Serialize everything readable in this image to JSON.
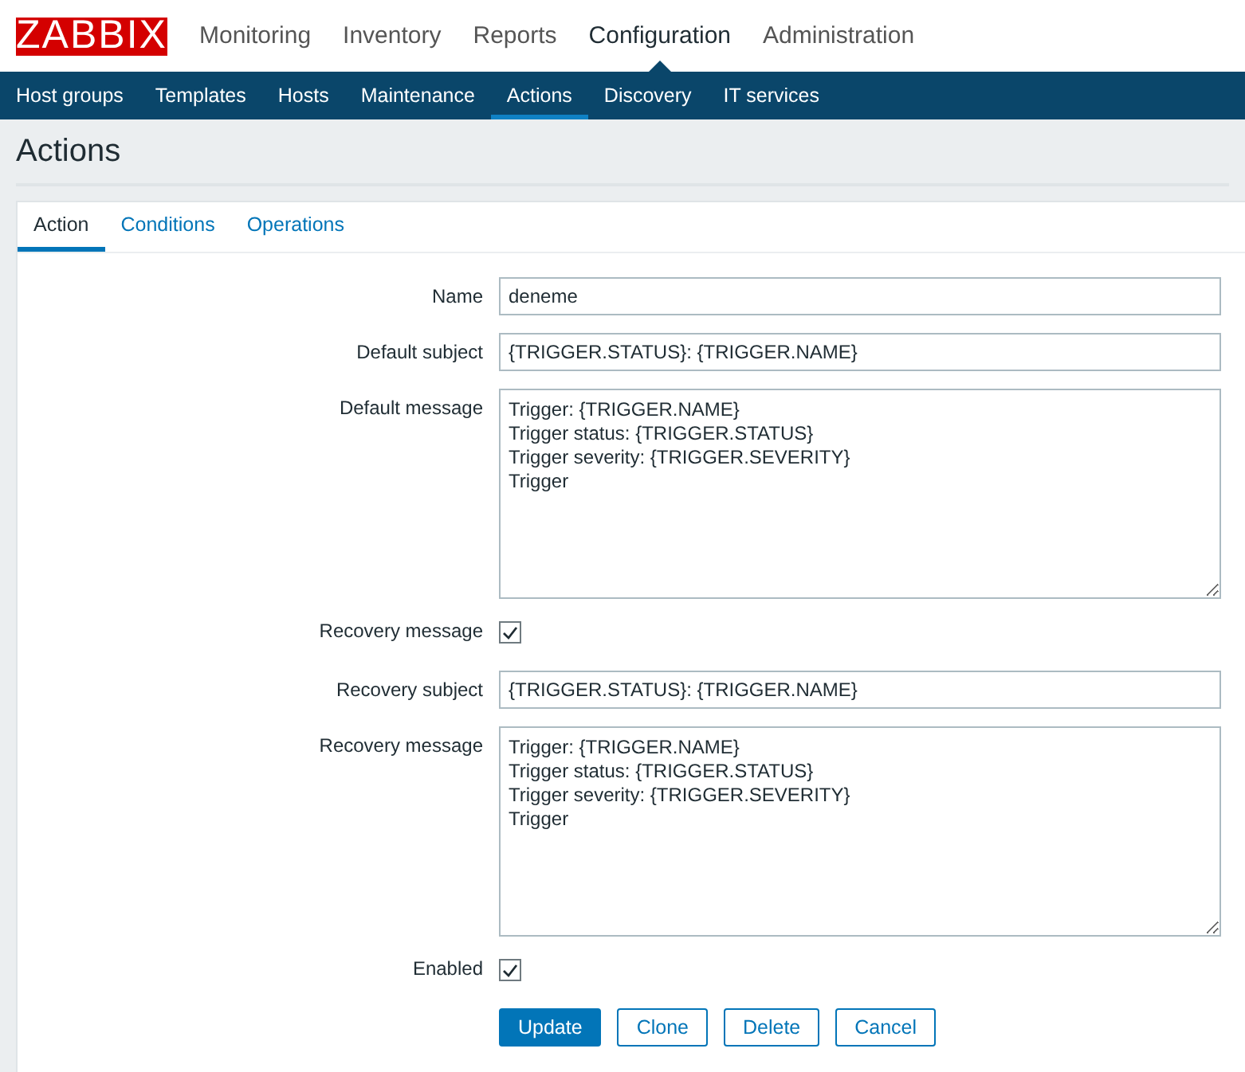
{
  "logo": "ZABBIX",
  "main_menu": [
    {
      "label": "Monitoring",
      "selected": false
    },
    {
      "label": "Inventory",
      "selected": false
    },
    {
      "label": "Reports",
      "selected": false
    },
    {
      "label": "Configuration",
      "selected": true
    },
    {
      "label": "Administration",
      "selected": false
    }
  ],
  "sub_menu": [
    {
      "label": "Host groups",
      "selected": false
    },
    {
      "label": "Templates",
      "selected": false
    },
    {
      "label": "Hosts",
      "selected": false
    },
    {
      "label": "Maintenance",
      "selected": false
    },
    {
      "label": "Actions",
      "selected": true
    },
    {
      "label": "Discovery",
      "selected": false
    },
    {
      "label": "IT services",
      "selected": false
    }
  ],
  "page_title": "Actions",
  "tabs": [
    {
      "label": "Action",
      "selected": true
    },
    {
      "label": "Conditions",
      "selected": false
    },
    {
      "label": "Operations",
      "selected": false
    }
  ],
  "form": [
    {
      "kind": "text",
      "label": "Name",
      "value": "deneme"
    },
    {
      "kind": "text",
      "label": "Default subject",
      "value": "{TRIGGER.STATUS}: {TRIGGER.NAME}"
    },
    {
      "kind": "textarea",
      "label": "Default message",
      "value": "Trigger: {TRIGGER.NAME}\nTrigger status: {TRIGGER.STATUS}\nTrigger severity: {TRIGGER.SEVERITY}\nTrigger"
    },
    {
      "kind": "checkbox",
      "label": "Recovery message",
      "checked": true
    },
    {
      "kind": "text",
      "label": "Recovery subject",
      "value": "{TRIGGER.STATUS}: {TRIGGER.NAME}"
    },
    {
      "kind": "textarea",
      "label": "Recovery message",
      "value": "Trigger: {TRIGGER.NAME}\nTrigger status: {TRIGGER.STATUS}\nTrigger severity: {TRIGGER.SEVERITY}\nTrigger"
    },
    {
      "kind": "checkbox",
      "label": "Enabled",
      "checked": true
    }
  ],
  "buttons": [
    {
      "label": "Update",
      "kind": "primary"
    },
    {
      "label": "Clone",
      "kind": "secondary"
    },
    {
      "label": "Delete",
      "kind": "secondary"
    },
    {
      "label": "Cancel",
      "kind": "secondary"
    }
  ]
}
